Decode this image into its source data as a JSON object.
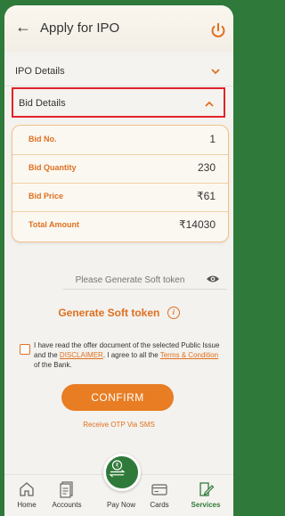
{
  "header": {
    "title": "Apply for IPO"
  },
  "accordions": {
    "ipo_details": "IPO Details",
    "bid_details": "Bid Details"
  },
  "bid": {
    "rows": [
      {
        "label": "Bid No.",
        "value": "1"
      },
      {
        "label": "Bid Quantity",
        "value": "230"
      },
      {
        "label": "Bid Price",
        "value": "₹61"
      },
      {
        "label": "Total Amount",
        "value": "₹14030"
      }
    ]
  },
  "soft_token": {
    "placeholder": "Please Generate Soft token",
    "generate_label": "Generate Soft token",
    "info_glyph": "i"
  },
  "disclaimer": {
    "text_1": "I have read the offer document of the selected Public Issue and the ",
    "link_1": "DISCLAIMER",
    "text_2": ". I agree to all the ",
    "link_2": "Terms & Condition",
    "text_3": " of the Bank."
  },
  "confirm_label": "CONFIRM",
  "otp_label": "Receive OTP Via SMS",
  "nav": {
    "items": [
      {
        "label": "Home",
        "icon": "home-icon"
      },
      {
        "label": "Accounts",
        "icon": "accounts-icon"
      },
      {
        "label": "Pay Now",
        "icon": "pay-now-icon"
      },
      {
        "label": "Cards",
        "icon": "card-icon"
      },
      {
        "label": "Services",
        "icon": "services-icon"
      }
    ]
  },
  "colors": {
    "accent": "#e07020",
    "brand": "#2f7a3a",
    "highlight": "#e2222a"
  }
}
